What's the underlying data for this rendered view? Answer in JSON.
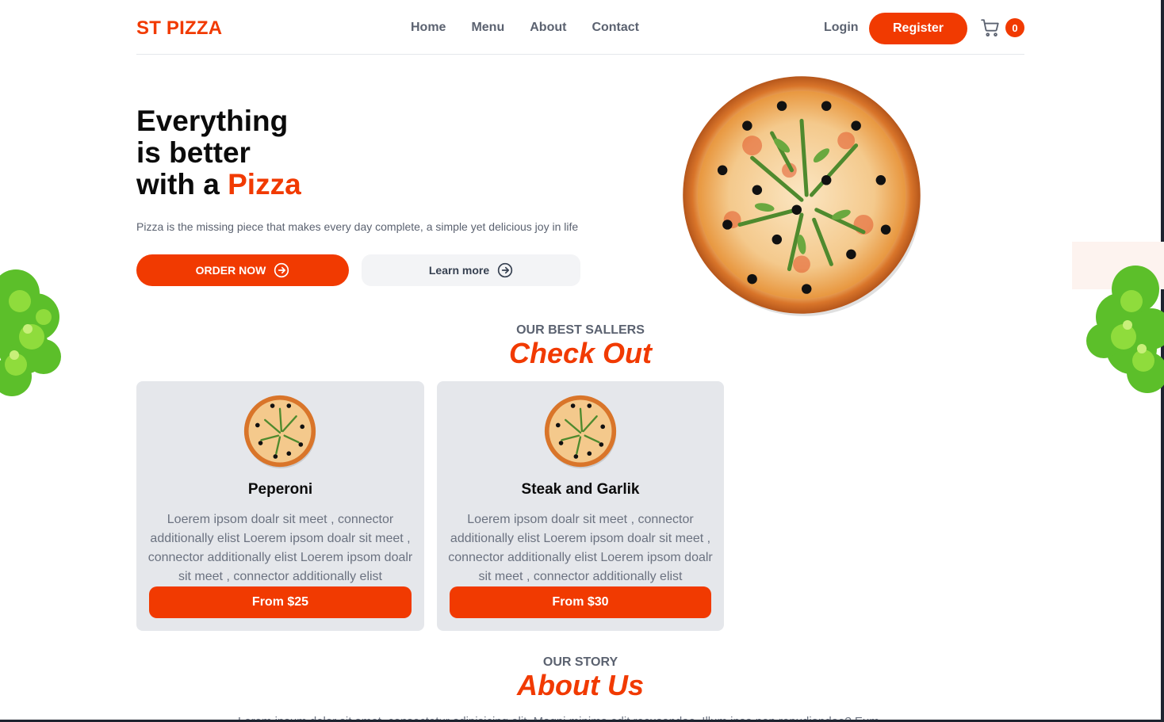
{
  "header": {
    "logo": "ST PIZZA",
    "nav": [
      "Home",
      "Menu",
      "About",
      "Contact"
    ],
    "login": "Login",
    "register": "Register",
    "cart_count": "0"
  },
  "hero": {
    "title_line1": "Everything",
    "title_line2": "is better",
    "title_line3_prefix": "with a ",
    "title_accent": "Pizza",
    "text": "Pizza is the missing piece that makes every day complete, a simple yet delicious joy in life",
    "order_button": "ORDER NOW",
    "learn_button": "Learn more"
  },
  "best_sellers": {
    "subtitle": "OUR BEST SALLERS",
    "title": "Check Out",
    "items": [
      {
        "name": "Peperoni",
        "description": "Loerem ipsom doalr sit meet , connector additionally elist Loerem ipsom doalr sit meet , connector additionally elist Loerem ipsom doalr sit meet , connector additionally elist",
        "price": "From $25"
      },
      {
        "name": "Steak and Garlik",
        "description": "Loerem ipsom doalr sit meet , connector additionally elist Loerem ipsom doalr sit meet , connector additionally elist Loerem ipsom doalr sit meet , connector additionally elist",
        "price": "From $30"
      }
    ]
  },
  "about": {
    "subtitle": "OUR STORY",
    "title": "About Us",
    "text": "Lorem ipsum dolor sit amet, consectetur adipisicing elit. Magni minima odit recusandae. Illum ipsa non repudiandae? Eum"
  },
  "colors": {
    "accent": "#f13a01",
    "muted_text": "#5b6270",
    "card_bg": "#e5e7eb"
  },
  "icons": [
    "cart-icon",
    "arrow-circle-right-icon",
    "pizza-image",
    "lettuce-image"
  ]
}
